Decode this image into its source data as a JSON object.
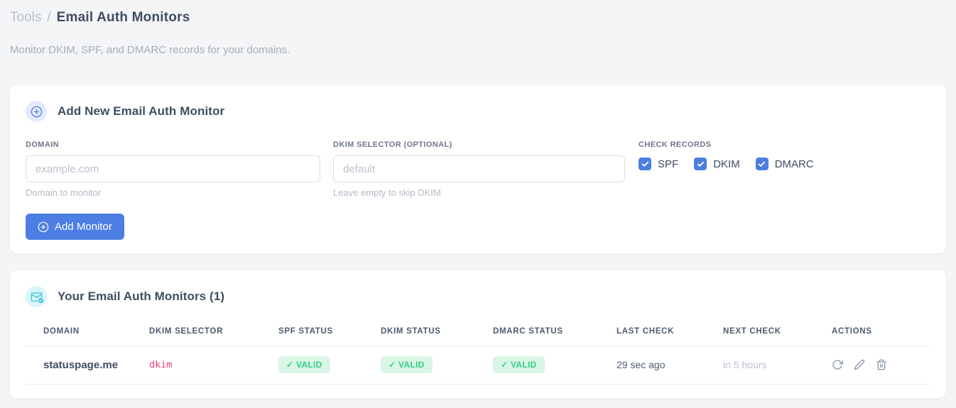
{
  "page": {
    "breadcrumb": {
      "section": "Tools",
      "separator": "/",
      "current": "Email Auth Monitors"
    },
    "subtitle": "Monitor DKIM, SPF, and DMARC records for your domains."
  },
  "add_monitor_card": {
    "title": "Add New Email Auth Monitor",
    "fields": {
      "domain": {
        "label": "DOMAIN",
        "placeholder": "example.com",
        "helper": "Domain to monitor",
        "value": ""
      },
      "dkim_selector": {
        "label": "DKIM SELECTOR (OPTIONAL)",
        "placeholder": "default",
        "helper": "Leave empty to skip DKIM",
        "value": ""
      }
    },
    "check_records": {
      "label": "CHECK RECORDS",
      "options": [
        {
          "label": "SPF",
          "checked": true
        },
        {
          "label": "DKIM",
          "checked": true
        },
        {
          "label": "DMARC",
          "checked": true
        }
      ]
    },
    "submit_label": "Add Monitor"
  },
  "monitors_card": {
    "title": "Your Email Auth Monitors (1)",
    "count": 1,
    "table": {
      "headers": [
        "DOMAIN",
        "DKIM SELECTOR",
        "SPF STATUS",
        "DKIM STATUS",
        "DMARC STATUS",
        "LAST CHECK",
        "NEXT CHECK",
        "ACTIONS"
      ],
      "rows": [
        {
          "domain": "statuspage.me",
          "dkim_selector": "dkim",
          "spf_status": "✓ VALID",
          "dkim_status": "✓ VALID",
          "dmarc_status": "✓ VALID",
          "last_check": "29 sec ago",
          "next_check": "in 5 hours",
          "actions": [
            "refresh",
            "edit",
            "delete"
          ]
        }
      ]
    }
  },
  "colors": {
    "accent_blue": "#4d7ee3",
    "badge_green_bg": "#d9f5e6",
    "badge_green_text": "#2ed180",
    "selector_pink": "#f23d7c",
    "icon_cyan": "#2bc4e2",
    "page_bg": "#f4f5f7"
  }
}
